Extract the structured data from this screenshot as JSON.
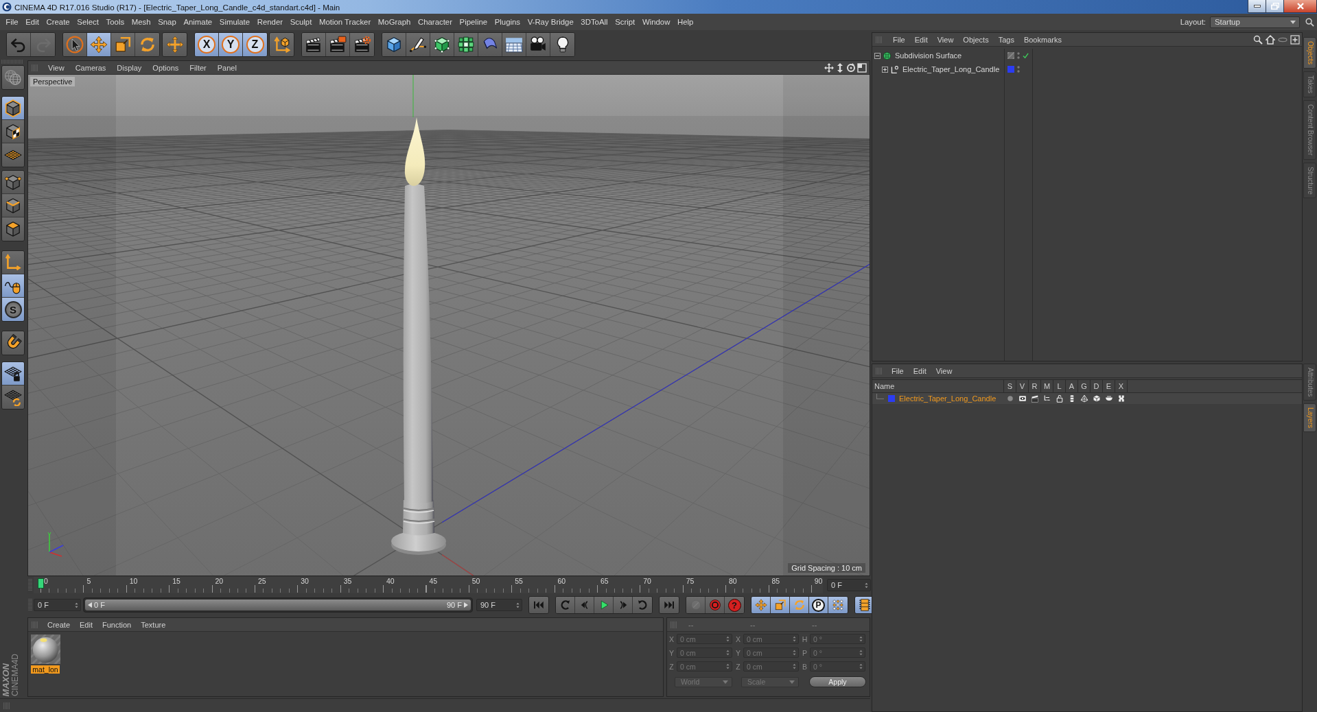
{
  "window": {
    "title": "CINEMA 4D R17.016 Studio (R17) - [Electric_Taper_Long_Candle_c4d_standart.c4d] - Main"
  },
  "menu_bar": {
    "items": [
      "File",
      "Edit",
      "Create",
      "Select",
      "Tools",
      "Mesh",
      "Snap",
      "Animate",
      "Simulate",
      "Render",
      "Sculpt",
      "Motion Tracker",
      "MoGraph",
      "Character",
      "Pipeline",
      "Plugins",
      "V-Ray Bridge",
      "3DToAll",
      "Script",
      "Window",
      "Help"
    ],
    "layout_label": "Layout:",
    "layout_value": "Startup"
  },
  "toolbar": {
    "groups": [
      [
        {
          "kind": "undo",
          "active": false,
          "disabled": false
        },
        {
          "kind": "redo",
          "active": false,
          "disabled": true
        }
      ],
      [
        {
          "kind": "live-selection",
          "active": false,
          "disabled": false
        },
        {
          "kind": "move",
          "active": true,
          "disabled": false
        },
        {
          "kind": "scale",
          "active": false,
          "disabled": false
        },
        {
          "kind": "rotate",
          "active": false,
          "disabled": false
        }
      ],
      [
        {
          "kind": "transform",
          "active": false,
          "disabled": false
        }
      ],
      [
        {
          "kind": "axis-lock",
          "label": "X",
          "active": true,
          "disabled": false
        },
        {
          "kind": "axis-lock",
          "label": "Y",
          "active": true,
          "disabled": false
        },
        {
          "kind": "axis-lock",
          "label": "Z",
          "active": true,
          "disabled": false
        }
      ],
      [
        {
          "kind": "coordinate-system",
          "active": false,
          "disabled": false
        }
      ],
      [
        {
          "kind": "render-view",
          "active": false,
          "disabled": false
        },
        {
          "kind": "render-picture",
          "active": false,
          "disabled": false
        },
        {
          "kind": "render-settings",
          "active": false,
          "disabled": false
        }
      ],
      [
        {
          "kind": "cube",
          "active": false,
          "disabled": false
        },
        {
          "kind": "pen",
          "active": false,
          "disabled": false
        },
        {
          "kind": "subdivision",
          "active": false,
          "disabled": false
        },
        {
          "kind": "cloner",
          "active": false,
          "disabled": false
        },
        {
          "kind": "deformer",
          "active": false,
          "disabled": false
        },
        {
          "kind": "floor",
          "active": false,
          "disabled": false
        },
        {
          "kind": "camera",
          "active": false,
          "disabled": false
        },
        {
          "kind": "light",
          "active": false,
          "disabled": false
        }
      ]
    ]
  },
  "left_toolbar": {
    "groups": [
      [
        {
          "kind": "model",
          "active": false
        }
      ],
      [
        {
          "kind": "object",
          "active": true
        },
        {
          "kind": "texture",
          "active": false
        },
        {
          "kind": "workplane",
          "active": false
        }
      ],
      [
        {
          "kind": "points",
          "active": false
        },
        {
          "kind": "edges",
          "active": false
        },
        {
          "kind": "polygons",
          "active": false
        }
      ],
      [
        {
          "kind": "axis",
          "active": false
        },
        {
          "kind": "tweak",
          "active": true
        },
        {
          "kind": "solo",
          "label": "S",
          "active": true
        }
      ],
      [
        {
          "kind": "snap",
          "active": false
        }
      ],
      [
        {
          "kind": "lock-workplane",
          "active": true
        },
        {
          "kind": "planar-workplane",
          "active": false
        }
      ]
    ]
  },
  "logo": {
    "brand": "MAXON",
    "product": "CINEMA4D"
  },
  "viewport": {
    "menu": [
      "View",
      "Cameras",
      "Display",
      "Options",
      "Filter",
      "Panel"
    ],
    "camera": "Perspective",
    "grid_spacing": "Grid Spacing : 10 cm"
  },
  "timeline": {
    "ticks": [
      "0",
      "5",
      "10",
      "15",
      "20",
      "25",
      "30",
      "35",
      "40",
      "45",
      "50",
      "55",
      "60",
      "65",
      "70",
      "75",
      "80",
      "85",
      "90"
    ],
    "playhead": {
      "level": 0
    },
    "current_frame": "0 F"
  },
  "transport": {
    "start_field": "0 F",
    "range": {
      "start": "0 F",
      "end": "90 F",
      "level": 1
    },
    "end_field": "90 F",
    "groups": [
      [
        {
          "kind": "go-start",
          "active": false,
          "disabled": false
        }
      ],
      [
        {
          "kind": "previous-key",
          "active": false,
          "disabled": false
        },
        {
          "kind": "previous-frame",
          "active": false,
          "disabled": false
        },
        {
          "kind": "play",
          "active": false,
          "disabled": false
        },
        {
          "kind": "next-frame",
          "active": false,
          "disabled": false
        },
        {
          "kind": "next-key",
          "active": false,
          "disabled": false
        }
      ],
      [
        {
          "kind": "go-end",
          "active": false,
          "disabled": false
        }
      ],
      [
        {
          "kind": "record-objects",
          "active": false,
          "disabled": true
        },
        {
          "kind": "autokey",
          "active": false,
          "disabled": false
        },
        {
          "kind": "keyframe-selection",
          "label": "?",
          "active": false,
          "disabled": false
        }
      ],
      [
        {
          "kind": "key-position",
          "active": true,
          "disabled": false
        },
        {
          "kind": "key-scale",
          "active": true,
          "disabled": false
        },
        {
          "kind": "key-rotation",
          "active": true,
          "disabled": false
        },
        {
          "kind": "key-parameter",
          "label": "P",
          "active": true,
          "disabled": false
        },
        {
          "kind": "key-points",
          "active": true,
          "disabled": false
        }
      ],
      [
        {
          "kind": "timeline",
          "active": true,
          "disabled": false
        }
      ]
    ]
  },
  "materials": {
    "menu": [
      "Create",
      "Edit",
      "Function",
      "Texture"
    ],
    "items": [
      {
        "name": "mat_lon",
        "selected": true
      }
    ]
  },
  "coordinates": {
    "disabled": true,
    "headers": [
      "--",
      "--",
      "--"
    ],
    "rows": [
      {
        "position_axis": "X",
        "position": "0 cm",
        "size_axis": "X",
        "size": "0 cm",
        "rotation_axis": "H",
        "rotation": "0 °"
      },
      {
        "position_axis": "Y",
        "position": "0 cm",
        "size_axis": "Y",
        "size": "0 cm",
        "rotation_axis": "P",
        "rotation": "0 °"
      },
      {
        "position_axis": "Z",
        "position": "0 cm",
        "size_axis": "Z",
        "size": "0 cm",
        "rotation_axis": "B",
        "rotation": "0 °"
      }
    ],
    "mode": "World",
    "size_mode": "Scale",
    "apply": "Apply"
  },
  "object_manager": {
    "menu": [
      "File",
      "Edit",
      "View",
      "Objects",
      "Tags",
      "Bookmarks"
    ],
    "objects": [
      {
        "name": "Subdivision Surface",
        "kind": "subdivision",
        "selected": false,
        "expanded": true,
        "enabled": true,
        "children": [
          {
            "name": "Electric_Taper_Long_Candle",
            "kind": "null",
            "selected": false,
            "expanded": false,
            "color": "#2b3cf2"
          }
        ]
      }
    ]
  },
  "layer_manager": {
    "menu": [
      "File",
      "Edit",
      "View"
    ],
    "columns": [
      "Name",
      "S",
      "V",
      "R",
      "M",
      "L",
      "A",
      "G",
      "D",
      "E",
      "X"
    ],
    "layers": [
      {
        "name": "Electric_Taper_Long_Candle",
        "color": "#2b3cf2",
        "selected": true,
        "flags": [
          {
            "kind": "solo",
            "on": false
          },
          {
            "kind": "view",
            "on": true
          },
          {
            "kind": "render",
            "on": true
          },
          {
            "kind": "manager",
            "on": true
          },
          {
            "kind": "locked",
            "on": false
          },
          {
            "kind": "animation",
            "on": true
          },
          {
            "kind": "generators",
            "on": true
          },
          {
            "kind": "deformers",
            "on": true
          },
          {
            "kind": "expressions",
            "on": true
          },
          {
            "kind": "xrefs",
            "on": true
          }
        ]
      }
    ]
  },
  "side_tabs": {
    "top": [
      {
        "label": "Objects",
        "selected": true
      },
      {
        "label": "Takes",
        "selected": false
      },
      {
        "label": "Content Browser",
        "selected": false
      },
      {
        "label": "Structure",
        "selected": false
      }
    ],
    "bottom": [
      {
        "label": "Attributes",
        "selected": false
      },
      {
        "label": "Layers",
        "selected": true
      }
    ]
  }
}
